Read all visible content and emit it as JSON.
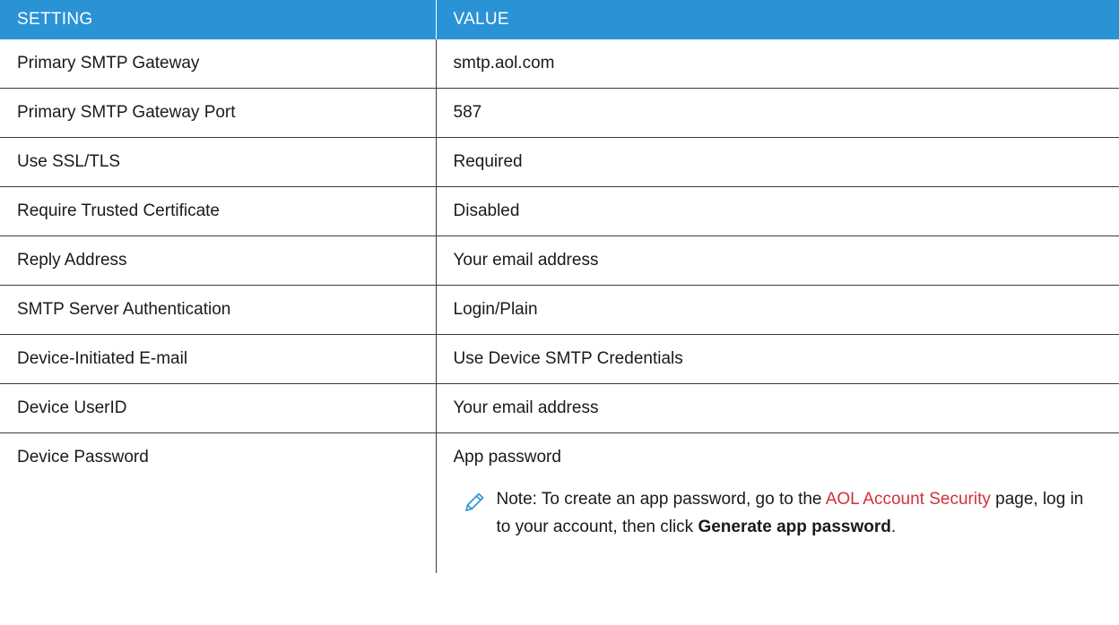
{
  "headers": {
    "setting": "SETTING",
    "value": "VALUE"
  },
  "rows": [
    {
      "setting": "Primary SMTP Gateway",
      "value": "smtp.aol.com"
    },
    {
      "setting": "Primary SMTP Gateway Port",
      "value": "587"
    },
    {
      "setting": "Use SSL/TLS",
      "value": "Required"
    },
    {
      "setting": "Require Trusted Certificate",
      "value": "Disabled"
    },
    {
      "setting": "Reply Address",
      "value": "Your email address"
    },
    {
      "setting": "SMTP Server Authentication",
      "value": "Login/Plain"
    },
    {
      "setting": "Device-Initiated E-mail",
      "value": "Use Device SMTP Credentials"
    },
    {
      "setting": "Device UserID",
      "value": "Your email address"
    },
    {
      "setting": "Device Password",
      "value": "App password"
    }
  ],
  "note": {
    "icon": "pencil-icon",
    "prefix": "Note: To create an app password, go to the ",
    "link_text": "AOL Account Security",
    "middle": " page, log in to your account, then click ",
    "bold_text": "Generate app password",
    "suffix": "."
  },
  "colors": {
    "header_bg": "#2a93d5",
    "link": "#d2303a"
  }
}
